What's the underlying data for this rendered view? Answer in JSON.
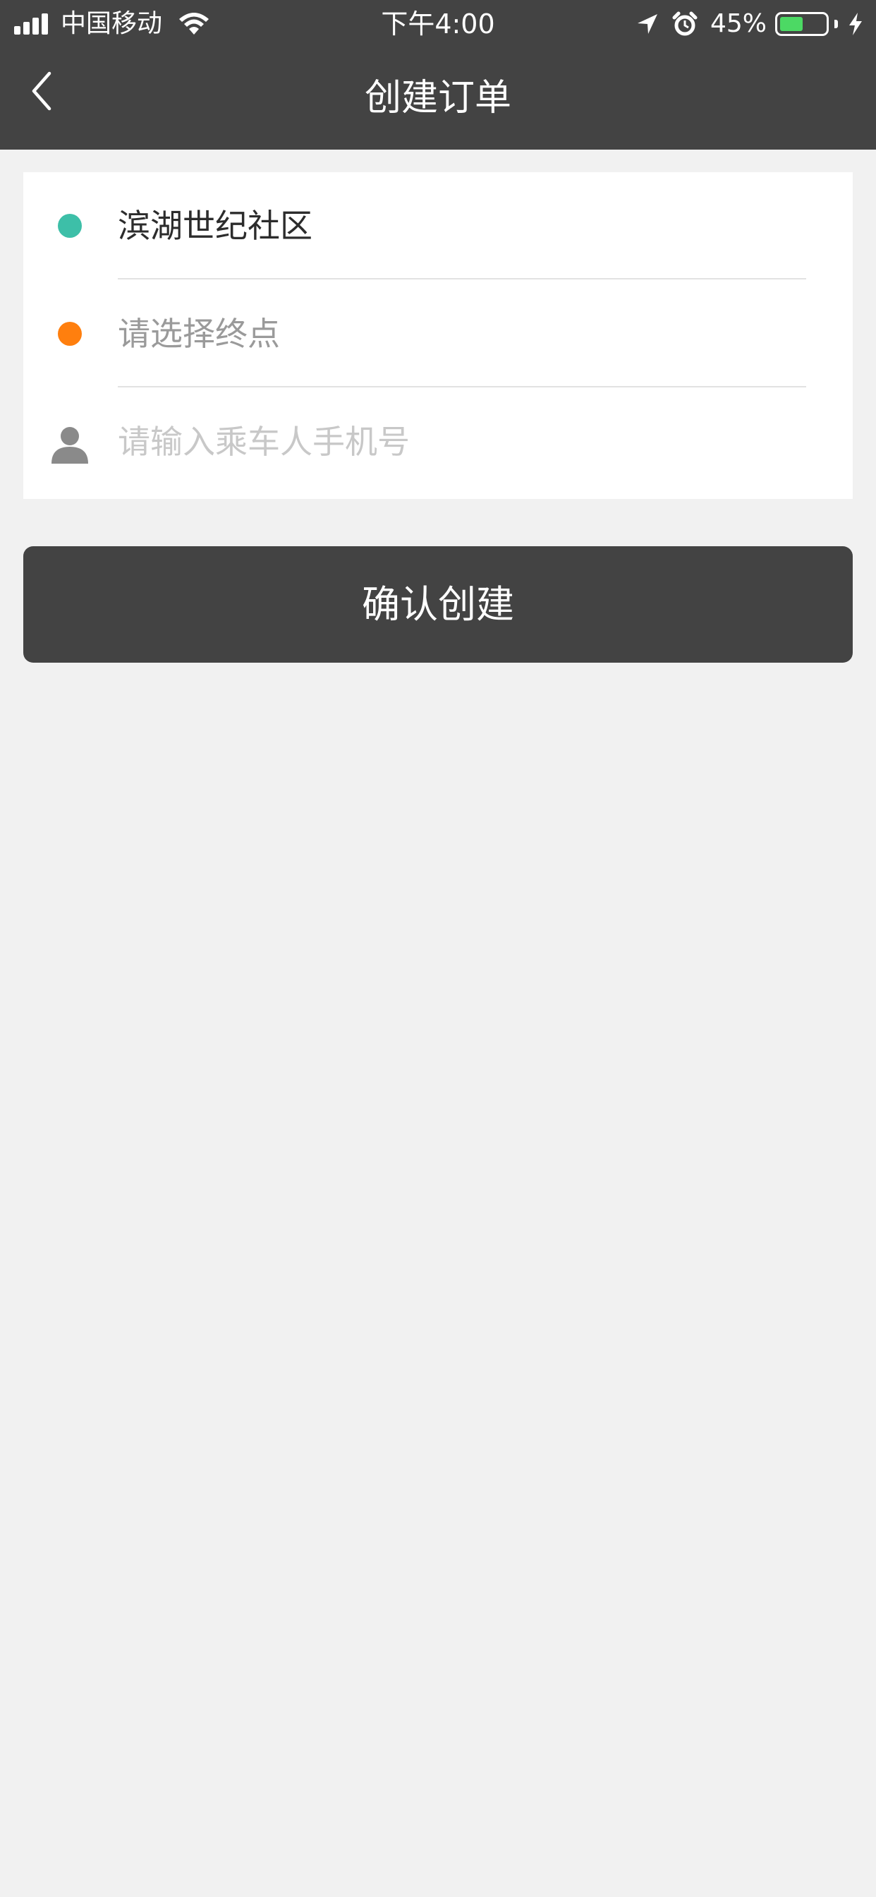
{
  "status_bar": {
    "carrier": "中国移动",
    "time": "下午4:00",
    "battery_percent": "45%",
    "battery_level": 0.45,
    "icons": [
      "signal-icon",
      "wifi-icon",
      "location-arrow-icon",
      "alarm-clock-icon",
      "battery-icon",
      "charging-bolt-icon"
    ]
  },
  "nav": {
    "title": "创建订单",
    "back_icon": "chevron-left-icon"
  },
  "form": {
    "start": {
      "value": "滨湖世纪社区",
      "dot_color": "#3dbfa8"
    },
    "end": {
      "placeholder": "请选择终点",
      "dot_color": "#ff7f0e"
    },
    "phone": {
      "placeholder": "请输入乘车人手机号",
      "icon": "user-icon"
    }
  },
  "confirm": {
    "label": "确认创建"
  },
  "colors": {
    "header_bg": "#434343",
    "page_bg": "#f1f1f1",
    "button_bg": "#434343",
    "battery_fill": "#4cd964"
  }
}
